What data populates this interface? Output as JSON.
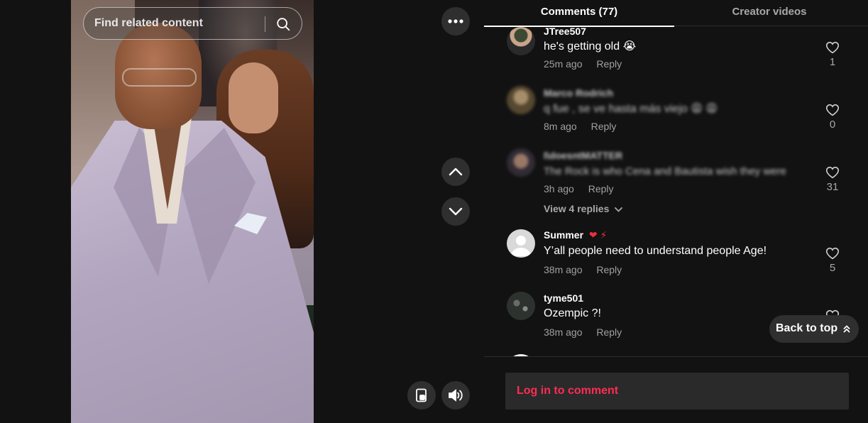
{
  "search": {
    "placeholder": "Find related content"
  },
  "tabs": [
    {
      "label": "Comments (77)",
      "active": true
    },
    {
      "label": "Creator videos",
      "active": false
    }
  ],
  "comments": [
    {
      "username": "JTree507",
      "text": "he's getting old 😭",
      "time": "25m ago",
      "reply": "Reply",
      "likes": "1",
      "blurred": false
    },
    {
      "username": "Marco Rodrich",
      "text": "q fue , se ve hasta más viejo 😩 😩",
      "time": "8m ago",
      "reply": "Reply",
      "likes": "0",
      "blurred": true
    },
    {
      "username": "I\\doesntMATTER",
      "text": "The Rock is who Cena and Bautista wish they were",
      "time": "3h ago",
      "reply": "Reply",
      "likes": "31",
      "blurred": true,
      "view_replies": "View 4 replies"
    },
    {
      "username": "Summer",
      "badges": "❤ ⚡",
      "text": "Y’all people need to understand people Age!",
      "time": "38m ago",
      "reply": "Reply",
      "likes": "5",
      "blurred": false
    },
    {
      "username": "tyme501",
      "text": "Ozempic ?!",
      "time": "38m ago",
      "reply": "Reply",
      "blurred": false
    }
  ],
  "back_to_top": "Back to top",
  "login_prompt": "Log in to comment",
  "icons": {
    "search": "search-icon",
    "more": "more-icon",
    "up": "chevron-up-icon",
    "down": "chevron-down-icon",
    "miniplayer": "floating-player-icon",
    "volume": "volume-icon",
    "heart": "heart-outline-icon",
    "back_to_top": "double-chevron-up-icon"
  },
  "colors": {
    "accent": "#fe2c55",
    "background": "#121212",
    "muted": "#a8a8a8"
  }
}
